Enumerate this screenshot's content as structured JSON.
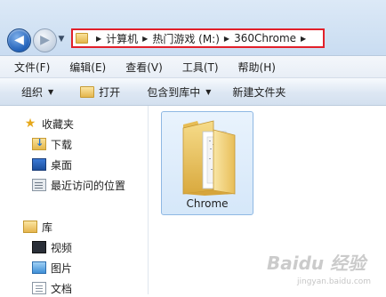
{
  "address_bar": {
    "crumbs": [
      "计算机",
      "热门游戏 (M:)",
      "360Chrome"
    ]
  },
  "menu": {
    "items": [
      "文件(F)",
      "编辑(E)",
      "查看(V)",
      "工具(T)",
      "帮助(H)"
    ]
  },
  "toolbar": {
    "organize": "组织",
    "open": "打开",
    "include_in_library": "包含到库中",
    "new_folder": "新建文件夹"
  },
  "sidebar": {
    "favorites": "收藏夹",
    "downloads": "下载",
    "desktop": "桌面",
    "recent": "最近访问的位置",
    "libraries": "库",
    "videos": "视频",
    "pictures": "图片",
    "documents": "文档"
  },
  "files": [
    {
      "name": "Chrome"
    }
  ],
  "watermark": {
    "text": "Baidu 经验",
    "sub": "jingyan.baidu.com"
  }
}
